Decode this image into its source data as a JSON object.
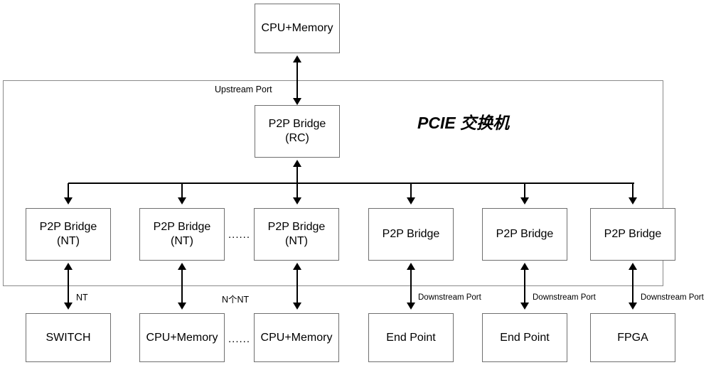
{
  "diagram": {
    "title": "PCIE 交换机",
    "container_label": "switch-boundary"
  },
  "top": {
    "cpu_memory": "CPU+Memory"
  },
  "root": {
    "line1": "P2P Bridge",
    "line2": "(RC)"
  },
  "labels": {
    "upstream_port": "Upstream Port",
    "nt": "NT",
    "n_nt": "N个NT",
    "downstream_port_1": "Downstream Port",
    "downstream_port_2": "Downstream Port",
    "downstream_port_3": "Downstream Port",
    "ellipsis_bridges": "......",
    "ellipsis_endpoints": "......"
  },
  "bridges": [
    {
      "line1": "P2P Bridge",
      "line2": "(NT)"
    },
    {
      "line1": "P2P Bridge",
      "line2": "(NT)"
    },
    {
      "line1": "P2P Bridge",
      "line2": "(NT)"
    },
    {
      "line1": "P2P Bridge",
      "line2": ""
    },
    {
      "line1": "P2P Bridge",
      "line2": ""
    },
    {
      "line1": "P2P Bridge",
      "line2": ""
    }
  ],
  "endpoints": [
    {
      "label": "SWITCH"
    },
    {
      "label": "CPU+Memory"
    },
    {
      "label": "CPU+Memory"
    },
    {
      "label": "End Point"
    },
    {
      "label": "End Point"
    },
    {
      "label": "FPGA"
    }
  ],
  "colors": {
    "box_border": "#6f6f6f",
    "container_border": "#8a8a8a",
    "line": "#000000",
    "text": "#000000",
    "background": "#ffffff"
  }
}
